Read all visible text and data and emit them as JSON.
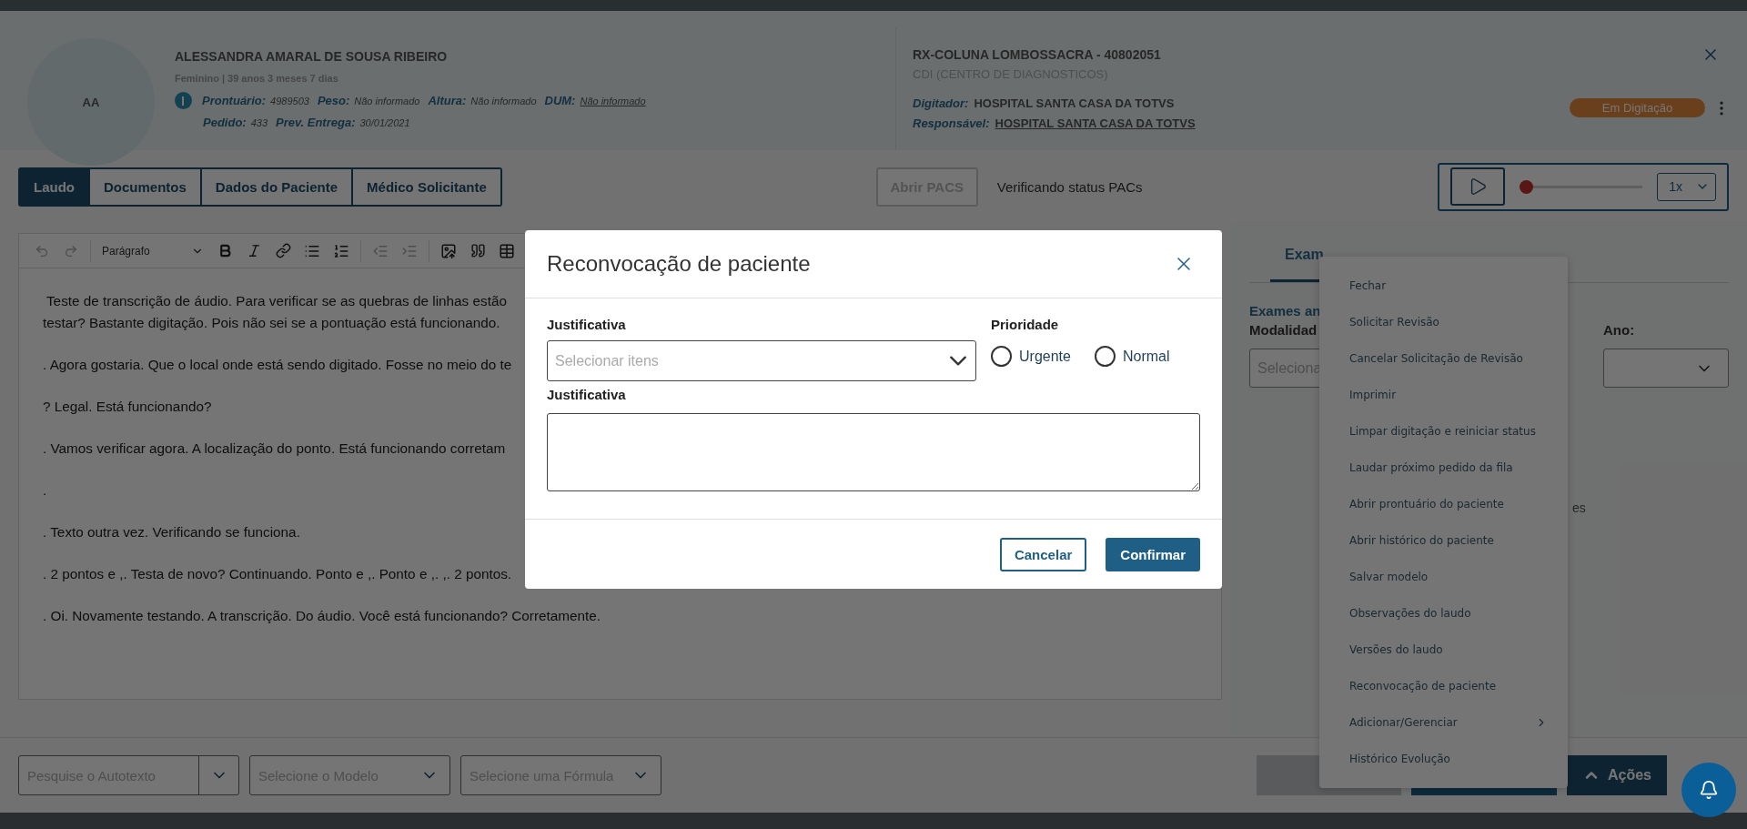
{
  "patient": {
    "initials": "AA",
    "name": "ALESSANDRA AMARAL DE SOUSA RIBEIRO",
    "details": "Feminino | 39 anos 3 meses 7 dias",
    "info_lines": [
      [
        {
          "label": "Prontuário:",
          "value": "4989503",
          "link": false
        },
        {
          "label": "Peso:",
          "value": "Não informado",
          "link": false
        },
        {
          "label": "Altura:",
          "value": "Não informado",
          "link": false
        },
        {
          "label": "DUM:",
          "value": "Não informado",
          "link": true
        }
      ],
      [
        {
          "label": "Pedido:",
          "value": "433",
          "link": false
        },
        {
          "label": "Prev. Entrega:",
          "value": "30/01/2021",
          "link": false
        }
      ]
    ]
  },
  "exam": {
    "title": "RX-COLUNA LOMBOSSACRA - 40802051",
    "unit": "CDI (CENTRO DE DIAGNOSTICOS)",
    "fields": [
      {
        "label": "Digitador:",
        "value": "HOSPITAL SANTA CASA DA TOTVS",
        "link": false
      },
      {
        "label": "Responsável:",
        "value": "HOSPITAL SANTA CASA DA TOTVS",
        "link": true
      }
    ],
    "status": "Em Digitação"
  },
  "tabs": [
    {
      "label": "Laudo",
      "selected": true
    },
    {
      "label": "Documentos",
      "selected": false
    },
    {
      "label": "Dados do Paciente",
      "selected": false
    },
    {
      "label": "Médico Solicitante",
      "selected": false
    }
  ],
  "pacs": {
    "button": "Abrir PACS",
    "disabled": true,
    "status": "Verificando status PACs"
  },
  "player": {
    "level": 0,
    "speed": "1x"
  },
  "editor": {
    "block_style": "Parágrafo",
    "paragraphs": [
      " Teste de transcrição de áudio. Para verificar se as quebras de linhas estão\ntestar? Bastante digitação. Pois não sei se a pontuação está funcionando.",
      ". Agora gostaria. Que o local onde está sendo digitado. Fosse no meio do te",
      "? Legal. Está funcionando?",
      ". Vamos verificar agora. A localização do ponto. Está funcionando corretam",
      ".",
      ". Texto outra vez. Verificando se funciona.",
      ". 2 pontos e ,. Testa de novo? Continuando. Ponto e ,. Ponto e ,. ,. 2 pontos.",
      ". Oi. Novamente testando. A transcrição. Do áudio. Você está funcionando? Corretamente."
    ]
  },
  "side_panel": {
    "tabs": [
      {
        "label": "Exam",
        "selected": true
      }
    ],
    "heading": "Exames an",
    "modality_label": "Modalidad",
    "modality_placeholder": "Seleciona",
    "year_label": "Ano:",
    "fragment": "es"
  },
  "bottom": {
    "selects": [
      {
        "placeholder": "Pesquise o Autotexto",
        "split": true
      },
      {
        "placeholder": "Selecione o Modelo",
        "split": false
      },
      {
        "placeholder": "Selecione uma Fórmula",
        "split": false
      }
    ],
    "actions_button": "Ações"
  },
  "menu": {
    "items": [
      {
        "label": "Fechar",
        "submenu": false
      },
      {
        "label": "Solicitar Revisão",
        "submenu": false
      },
      {
        "label": "Cancelar Solicitação de Revisão",
        "submenu": false
      },
      {
        "label": "Imprimir",
        "submenu": false
      },
      {
        "label": "Limpar digitação e reiniciar status",
        "submenu": false
      },
      {
        "label": "Laudar próximo pedido da fila",
        "submenu": false
      },
      {
        "label": "Abrir prontuário do paciente",
        "submenu": false
      },
      {
        "label": "Abrir histórico do paciente",
        "submenu": false
      },
      {
        "label": "Salvar modelo",
        "submenu": false
      },
      {
        "label": "Observações do laudo",
        "submenu": false
      },
      {
        "label": "Versões do laudo",
        "submenu": false
      },
      {
        "label": "Reconvocação de paciente",
        "submenu": false
      },
      {
        "label": "Adicionar/Gerenciar",
        "submenu": true
      },
      {
        "label": "Histórico Evolução",
        "submenu": false
      }
    ]
  },
  "modal": {
    "title": "Reconvocação de paciente",
    "select_label": "Justificativa",
    "select_placeholder": "Selecionar itens",
    "priority_label": "Prioridade",
    "priorities": [
      {
        "label": "Urgente",
        "selected": false
      },
      {
        "label": "Normal",
        "selected": false
      }
    ],
    "text_label": "Justificativa",
    "buttons": [
      {
        "label": "Cancelar",
        "kind": "secondary"
      },
      {
        "label": "Confirmar",
        "kind": "primary"
      }
    ]
  }
}
